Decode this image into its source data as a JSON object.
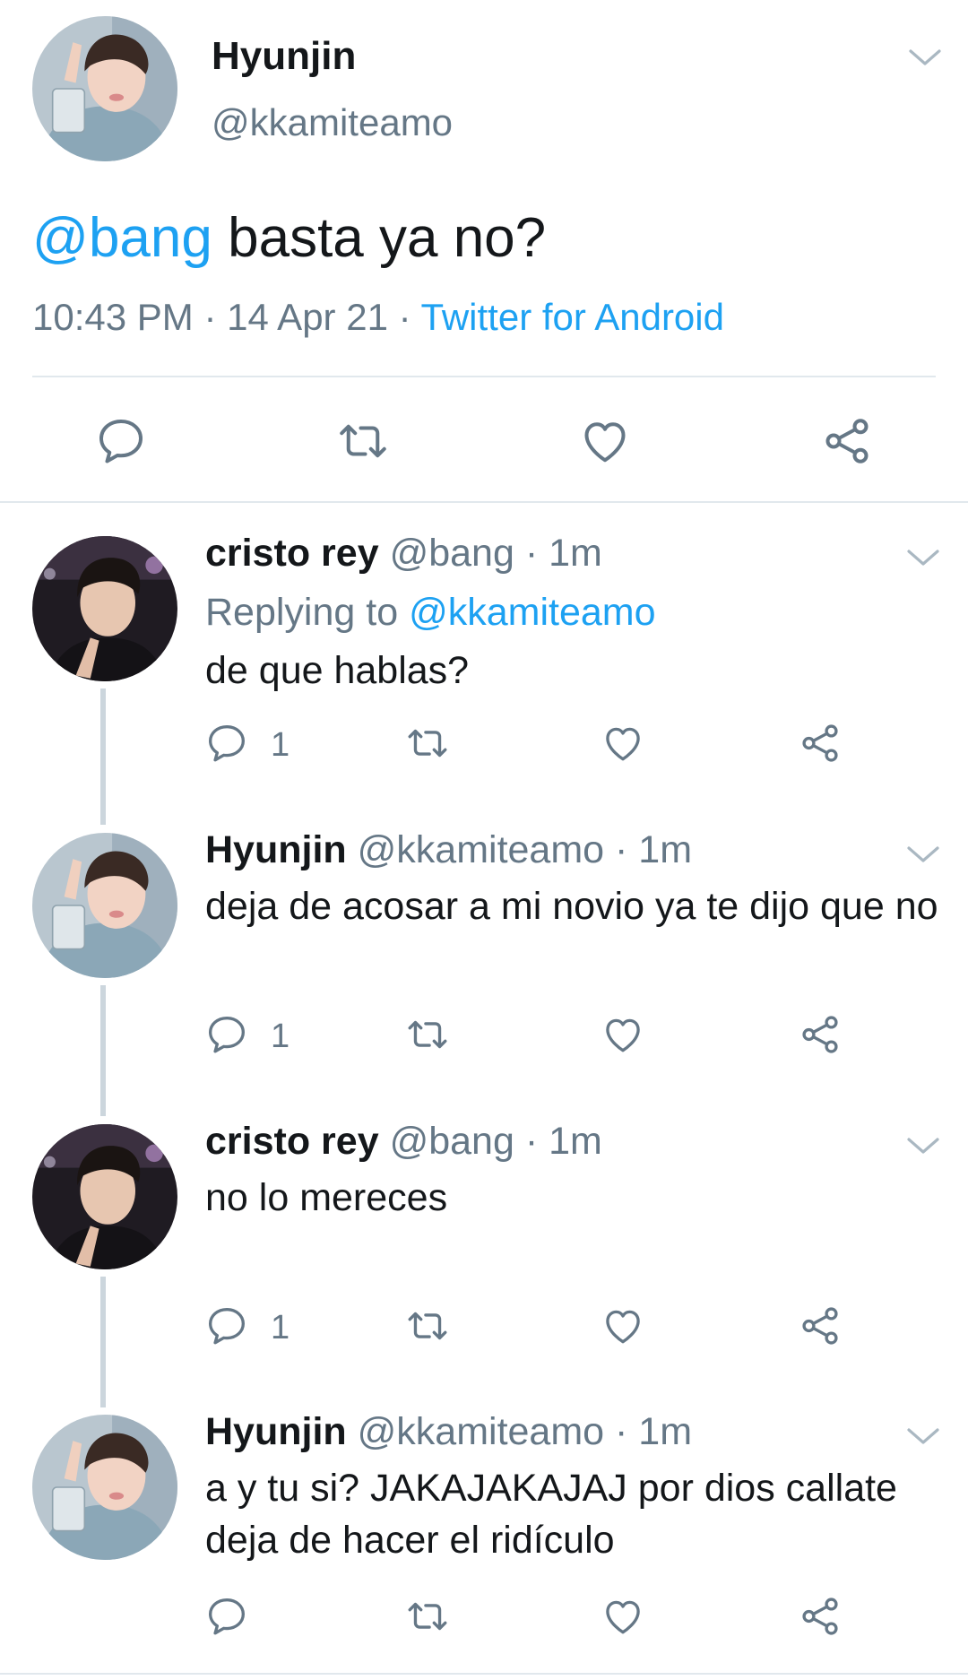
{
  "main_tweet": {
    "name": "Hyunjin",
    "handle": "@kkamiteamo",
    "text_mention": "@bang",
    "text_body": " basta ya no?",
    "time": "10:43 PM",
    "date": "14 Apr 21",
    "meta_sep": " · ",
    "source": "Twitter for Android"
  },
  "replies": [
    {
      "name": "cristo rey",
      "handle": "@bang",
      "age": "1m",
      "replying_label": "Replying to ",
      "replying_to": "@kkamiteamo",
      "text": "de que hablas?",
      "reply_count": "1"
    },
    {
      "name": "Hyunjin",
      "handle": "@kkamiteamo",
      "age": "1m",
      "text": "deja de acosar a mi novio ya te dijo que no",
      "reply_count": "1"
    },
    {
      "name": "cristo rey",
      "handle": "@bang",
      "age": "1m",
      "text": "no lo mereces",
      "reply_count": "1"
    },
    {
      "name": "Hyunjin",
      "handle": "@kkamiteamo",
      "age": "1m",
      "text": "a y tu si? JAKAJAKAJAJ por dios callate deja de hacer el ridículo",
      "reply_count": ""
    }
  ],
  "dot": " · ",
  "icons": {
    "reply": "reply-icon",
    "retweet": "retweet-icon",
    "like": "heart-icon",
    "share": "share-icon",
    "more": "chevron-down-icon"
  },
  "colors": {
    "link": "#1da1f2",
    "secondary": "#657786",
    "primary_text": "#14171a",
    "divider": "#e1e8ed",
    "thread_line": "#ccd6dd"
  }
}
